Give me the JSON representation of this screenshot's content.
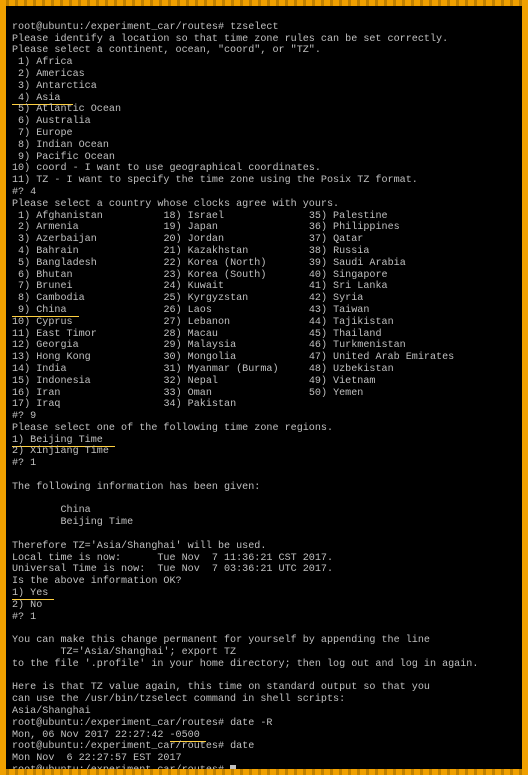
{
  "prompt1": "root@ubuntu:/experiment_car/routes# ",
  "cmd1": "tzselect",
  "intro1": "Please identify a location so that time zone rules can be set correctly.",
  "intro2": "Please select a continent, ocean, \"coord\", or \"TZ\".",
  "c1": " 1) Africa",
  "c2": " 2) Americas",
  "c3": " 3) Antarctica",
  "c4": " 4) Asia  ",
  "c5": " 5) Atlantic Ocean",
  "c6": " 6) Australia",
  "c7": " 7) Europe",
  "c8": " 8) Indian Ocean",
  "c9": " 9) Pacific Ocean",
  "c10": "10) coord - I want to use geographical coordinates.",
  "c11": "11) TZ - I want to specify the time zone using the Posix TZ format.",
  "q1": "#? 4",
  "countryPrompt": "Please select a country whose clocks agree with yours.",
  "r1a": " 1) Afghanistan",
  "r1b": "18) Israel",
  "r1c": "35) Palestine",
  "r2a": " 2) Armenia",
  "r2b": "19) Japan",
  "r2c": "36) Philippines",
  "r3a": " 3) Azerbaijan",
  "r3b": "20) Jordan",
  "r3c": "37) Qatar",
  "r4a": " 4) Bahrain",
  "r4b": "21) Kazakhstan",
  "r4c": "38) Russia",
  "r5a": " 5) Bangladesh",
  "r5b": "22) Korea (North)",
  "r5c": "39) Saudi Arabia",
  "r6a": " 6) Bhutan",
  "r6b": "23) Korea (South)",
  "r6c": "40) Singapore",
  "r7a": " 7) Brunei",
  "r7b": "24) Kuwait",
  "r7c": "41) Sri Lanka",
  "r8a": " 8) Cambodia",
  "r8b": "25) Kyrgyzstan",
  "r8c": "42) Syria",
  "r9a": " 9) China  ",
  "r9b": "26) Laos",
  "r9c": "43) Taiwan",
  "r10a": "10) Cyprus",
  "r10b": "27) Lebanon",
  "r10c": "44) Tajikistan",
  "r11a": "11) East Timor",
  "r11b": "28) Macau",
  "r11c": "45) Thailand",
  "r12a": "12) Georgia",
  "r12b": "29) Malaysia",
  "r12c": "46) Turkmenistan",
  "r13a": "13) Hong Kong",
  "r13b": "30) Mongolia",
  "r13c": "47) United Arab Emirates",
  "r14a": "14) India",
  "r14b": "31) Myanmar (Burma)",
  "r14c": "48) Uzbekistan",
  "r15a": "15) Indonesia",
  "r15b": "32) Nepal",
  "r15c": "49) Vietnam",
  "r16a": "16) Iran",
  "r16b": "33) Oman",
  "r16c": "50) Yemen",
  "r17a": "17) Iraq",
  "r17b": "34) Pakistan",
  "q2": "#? 9",
  "regionPrompt": "Please select one of the following time zone regions.",
  "reg1": "1) Beijing Time  ",
  "reg2": "2) Xinjiang Time",
  "q3": "#? 1",
  "blank": "",
  "info1": "The following information has been given:",
  "info2": "        China",
  "info3": "        Beijing Time",
  "info4": "Therefore TZ='Asia/Shanghai' will be used.",
  "info5": "Local time is now:      Tue Nov  7 11:36:21 CST 2017.",
  "info6": "Universal Time is now:  Tue Nov  7 03:36:21 UTC 2017.",
  "info7": "Is the above information OK?",
  "yes": "1) Yes ",
  "no": "2) No",
  "q4": "#? 1",
  "perm1": "You can make this change permanent for yourself by appending the line",
  "perm2": "        TZ='Asia/Shanghai'; export TZ",
  "perm3": "to the file '.profile' in your home directory; then log out and log in again.",
  "perm4": "Here is that TZ value again, this time on standard output so that you",
  "perm5": "can use the /usr/bin/tzselect command in shell scripts:",
  "tzval": "Asia/Shanghai",
  "cmd2": "date -R",
  "out2a": "Mon, 06 Nov 2017 22:27:42 ",
  "out2b": "-0500 ",
  "cmd3": "date",
  "out3": "Mon Nov  6 22:27:57 EST 2017"
}
